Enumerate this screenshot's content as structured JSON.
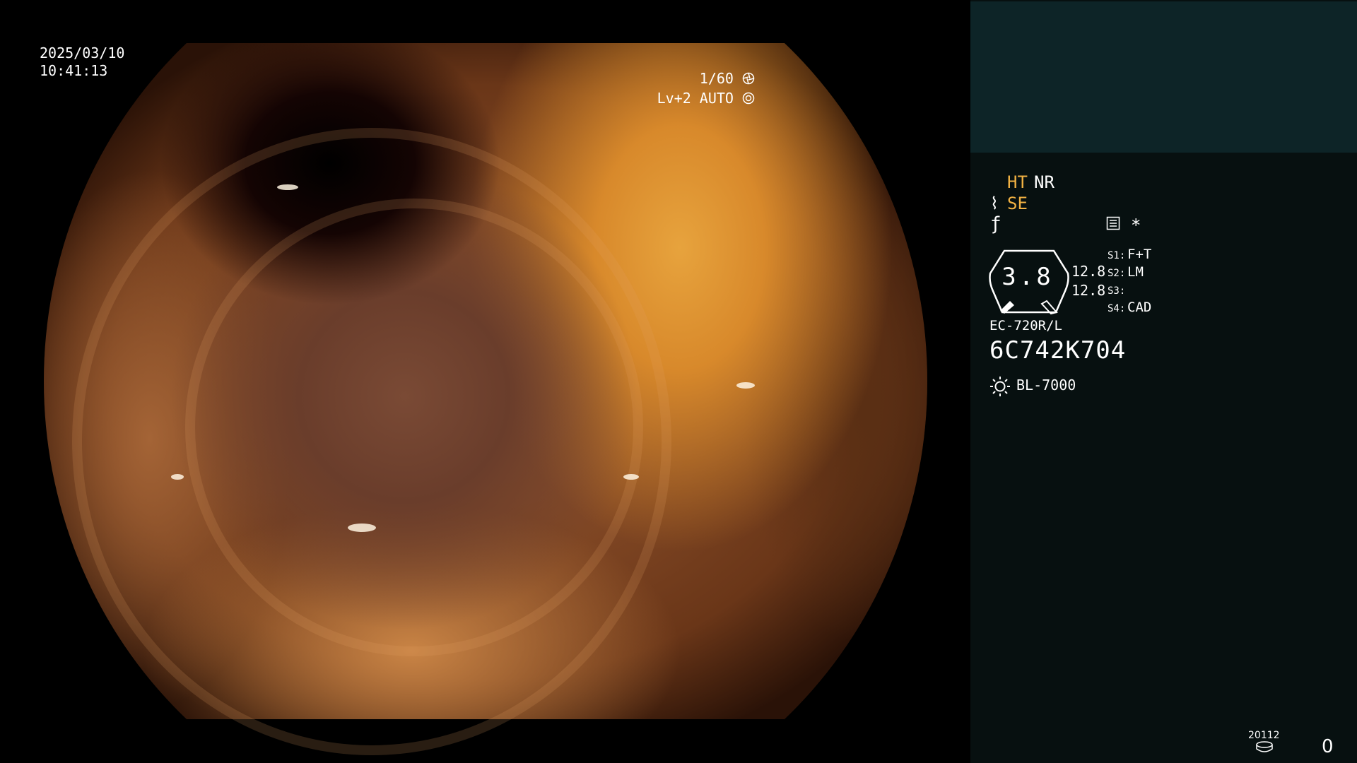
{
  "overlay": {
    "date": "2025/03/10",
    "time": "10:41:13",
    "shutter": "1/60",
    "shutter_icon": "shutter-icon",
    "level": "Lv+2 AUTO",
    "auto_icon": "iris-auto-icon"
  },
  "panel": {
    "ht": "HT",
    "nr": "NR",
    "se": "SE",
    "zoom": "3.8",
    "sub_values": [
      "12.8",
      "12.8"
    ],
    "switches": [
      {
        "key": "S1:",
        "value": "F+T"
      },
      {
        "key": "S2:",
        "value": "LM"
      },
      {
        "key": "S3:",
        "value": ""
      },
      {
        "key": "S4:",
        "value": "CAD"
      }
    ],
    "asterisk": "*",
    "scope_model": "EC-720R/L",
    "scope_serial": "6C742K704",
    "light_source": "BL-7000",
    "counter_label": "20112",
    "counter_value": "0"
  },
  "colors": {
    "accent_orange": "#f2b243",
    "panel_bg": "#071010",
    "panel_top_bg": "#0d2427"
  }
}
